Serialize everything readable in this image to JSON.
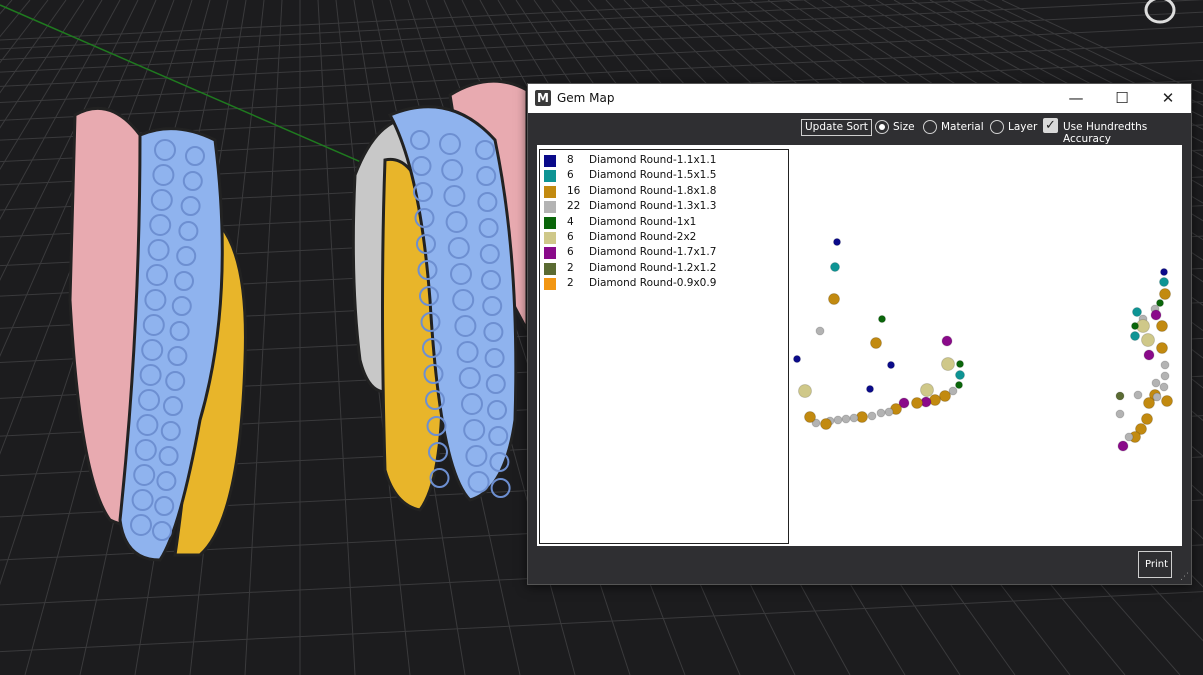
{
  "window": {
    "title": "Gem Map",
    "logo_letter": "M",
    "controls": {
      "minimize": "—",
      "maximize": "☐",
      "close": "✕"
    }
  },
  "toolbar": {
    "update_sort_label": "Update Sort",
    "sort_options": [
      {
        "label": "Size",
        "selected": true
      },
      {
        "label": "Material",
        "selected": false
      },
      {
        "label": "Layer",
        "selected": false
      }
    ],
    "hundredths_label": "Use Hundredths Accuracy",
    "hundredths_checked": true
  },
  "legend": [
    {
      "count": "8",
      "name": "Diamond Round-1.1x1.1",
      "color": "#0a0a8a"
    },
    {
      "count": "6",
      "name": "Diamond Round-1.5x1.5",
      "color": "#0e9494"
    },
    {
      "count": "16",
      "name": "Diamond Round-1.8x1.8",
      "color": "#c28a10"
    },
    {
      "count": "22",
      "name": "Diamond Round-1.3x1.3",
      "color": "#b3b3b3"
    },
    {
      "count": "4",
      "name": "Diamond Round-1x1",
      "color": "#0a660a"
    },
    {
      "count": "6",
      "name": "Diamond Round-2x2",
      "color": "#cfc889"
    },
    {
      "count": "6",
      "name": "Diamond Round-1.7x1.7",
      "color": "#8a0a8a"
    },
    {
      "count": "2",
      "name": "Diamond Round-1.2x1.2",
      "color": "#5b6b33"
    },
    {
      "count": "2",
      "name": "Diamond Round-0.9x0.9",
      "color": "#f29612"
    }
  ],
  "print_label": "Print",
  "viewport": {
    "background": "#1c1c1e",
    "grid_color": "#3a3a3c",
    "metal_pink": "#e8aab0",
    "metal_yellow": "#e8b52a",
    "metal_silver": "#c8c8c8",
    "stone_blue": "#8fb3ee"
  }
}
